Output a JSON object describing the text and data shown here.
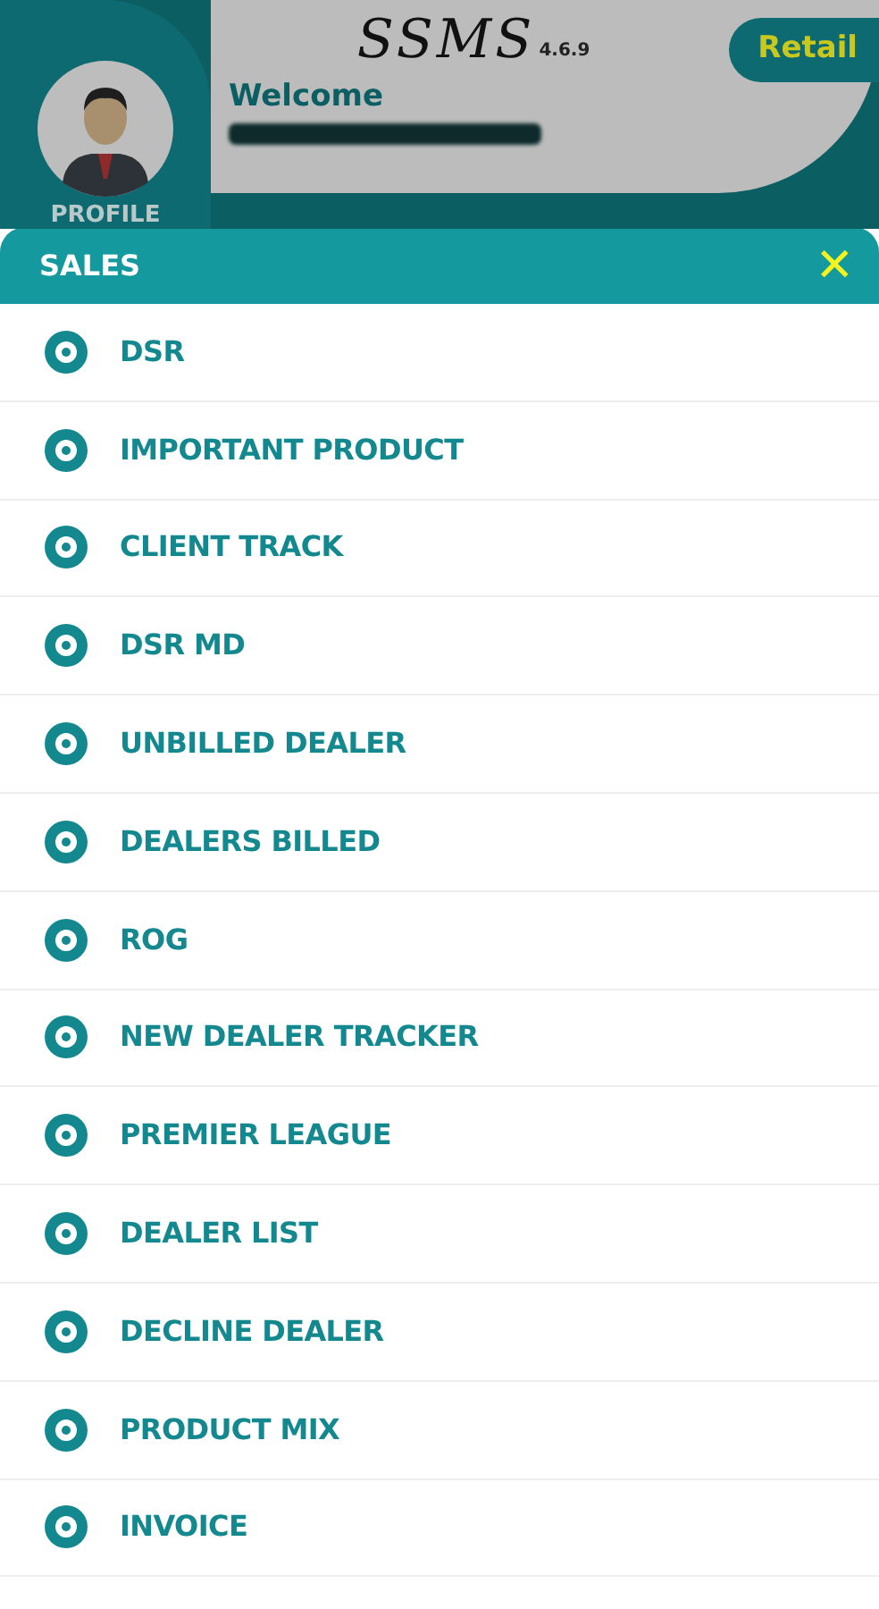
{
  "header": {
    "logo": "SSMS",
    "version": "4.6.9",
    "badge": "Retail",
    "welcome": "Welcome",
    "profile_label": "PROFILE"
  },
  "menu": {
    "title": "SALES",
    "close": "✕",
    "items": [
      {
        "label": "DSR"
      },
      {
        "label": "IMPORTANT PRODUCT"
      },
      {
        "label": "CLIENT TRACK"
      },
      {
        "label": "DSR MD"
      },
      {
        "label": "UNBILLED DEALER"
      },
      {
        "label": "DEALERS BILLED"
      },
      {
        "label": "ROG"
      },
      {
        "label": "NEW DEALER TRACKER"
      },
      {
        "label": "PREMIER LEAGUE"
      },
      {
        "label": "DEALER LIST"
      },
      {
        "label": "DECLINE DEALER"
      },
      {
        "label": "PRODUCT MIX"
      },
      {
        "label": "INVOICE"
      }
    ]
  }
}
